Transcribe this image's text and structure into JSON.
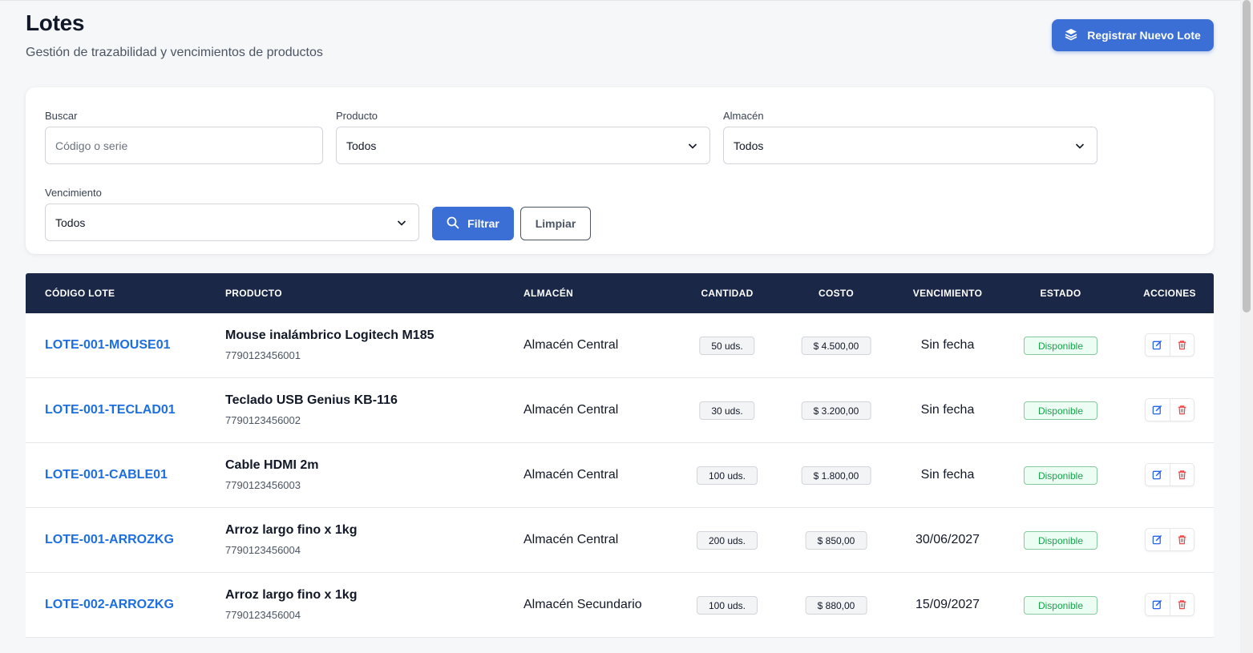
{
  "header": {
    "title": "Lotes",
    "subtitle": "Gestión de trazabilidad y vencimientos de productos",
    "new_button_label": "Registrar Nuevo Lote"
  },
  "filters": {
    "search_label": "Buscar",
    "search_placeholder": "Código o serie",
    "product_label": "Producto",
    "product_value": "Todos",
    "warehouse_label": "Almacén",
    "warehouse_value": "Todos",
    "expiry_label": "Vencimiento",
    "expiry_value": "Todos",
    "filter_button": "Filtrar",
    "clear_button": "Limpiar"
  },
  "table": {
    "headers": [
      "CÓDIGO LOTE",
      "PRODUCTO",
      "ALMACÉN",
      "CANTIDAD",
      "COSTO",
      "VENCIMIENTO",
      "ESTADO",
      "ACCIONES"
    ],
    "rows": [
      {
        "code": "LOTE-001-MOUSE01",
        "product": "Mouse inalámbrico Logitech M185",
        "barcode": "7790123456001",
        "warehouse": "Almacén Central",
        "qty": "50 uds.",
        "cost": "$ 4.500,00",
        "expiry": "Sin fecha",
        "status": "Disponible"
      },
      {
        "code": "LOTE-001-TECLAD01",
        "product": "Teclado USB Genius KB-116",
        "barcode": "7790123456002",
        "warehouse": "Almacén Central",
        "qty": "30 uds.",
        "cost": "$ 3.200,00",
        "expiry": "Sin fecha",
        "status": "Disponible"
      },
      {
        "code": "LOTE-001-CABLE01",
        "product": "Cable HDMI 2m",
        "barcode": "7790123456003",
        "warehouse": "Almacén Central",
        "qty": "100 uds.",
        "cost": "$ 1.800,00",
        "expiry": "Sin fecha",
        "status": "Disponible"
      },
      {
        "code": "LOTE-001-ARROZKG",
        "product": "Arroz largo fino x 1kg",
        "barcode": "7790123456004",
        "warehouse": "Almacén Central",
        "qty": "200 uds.",
        "cost": "$ 850,00",
        "expiry": "30/06/2027",
        "status": "Disponible"
      },
      {
        "code": "LOTE-002-ARROZKG",
        "product": "Arroz largo fino x 1kg",
        "barcode": "7790123456004",
        "warehouse": "Almacén Secundario",
        "qty": "100 uds.",
        "cost": "$ 880,00",
        "expiry": "15/09/2027",
        "status": "Disponible"
      }
    ]
  },
  "colors": {
    "primary": "#3b6fd6",
    "table_header": "#1b2746",
    "code_link": "#1d6fe0",
    "status_available": "#16a34a"
  }
}
